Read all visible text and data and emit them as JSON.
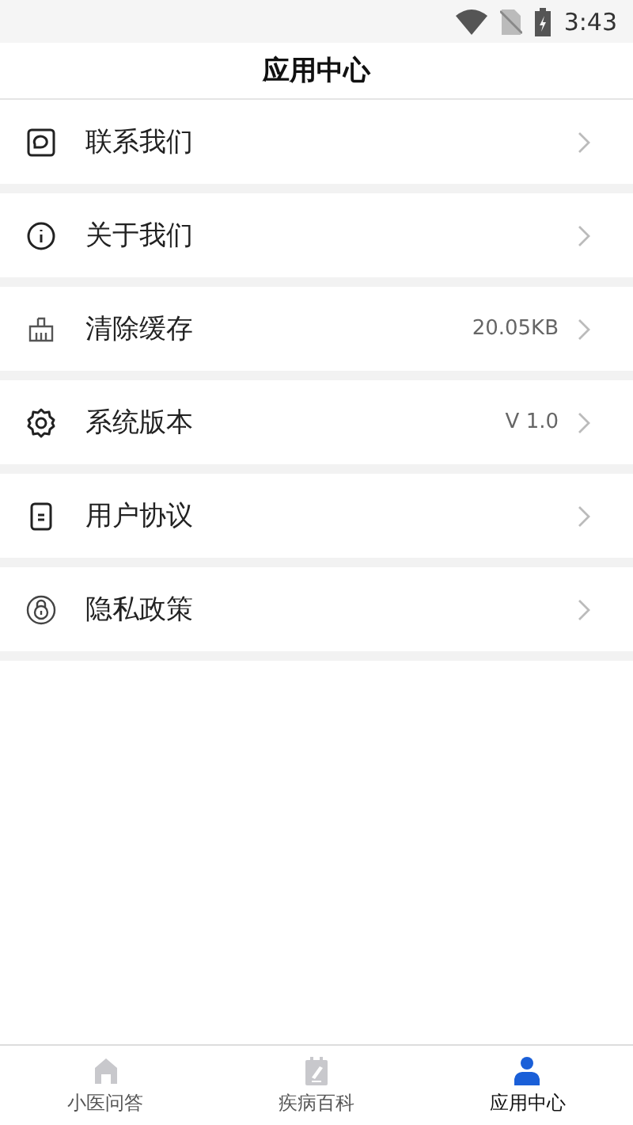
{
  "status_bar": {
    "time": "3:43"
  },
  "header": {
    "title": "应用中心"
  },
  "menu": [
    {
      "kind": "chat",
      "label": "联系我们"
    },
    {
      "kind": "info",
      "label": "关于我们"
    },
    {
      "kind": "broom",
      "label": "清除缓存",
      "value": "20.05KB"
    },
    {
      "kind": "gear",
      "label": "系统版本",
      "value": "V 1.0"
    },
    {
      "kind": "document",
      "label": "用户协议"
    },
    {
      "kind": "lock",
      "label": "隐私政策"
    }
  ],
  "tabs": [
    {
      "kind": "home",
      "label": "小医问答",
      "selected": false
    },
    {
      "kind": "calendar",
      "label": "疾病百科",
      "selected": false
    },
    {
      "kind": "person",
      "label": "应用中心",
      "selected": true
    }
  ]
}
